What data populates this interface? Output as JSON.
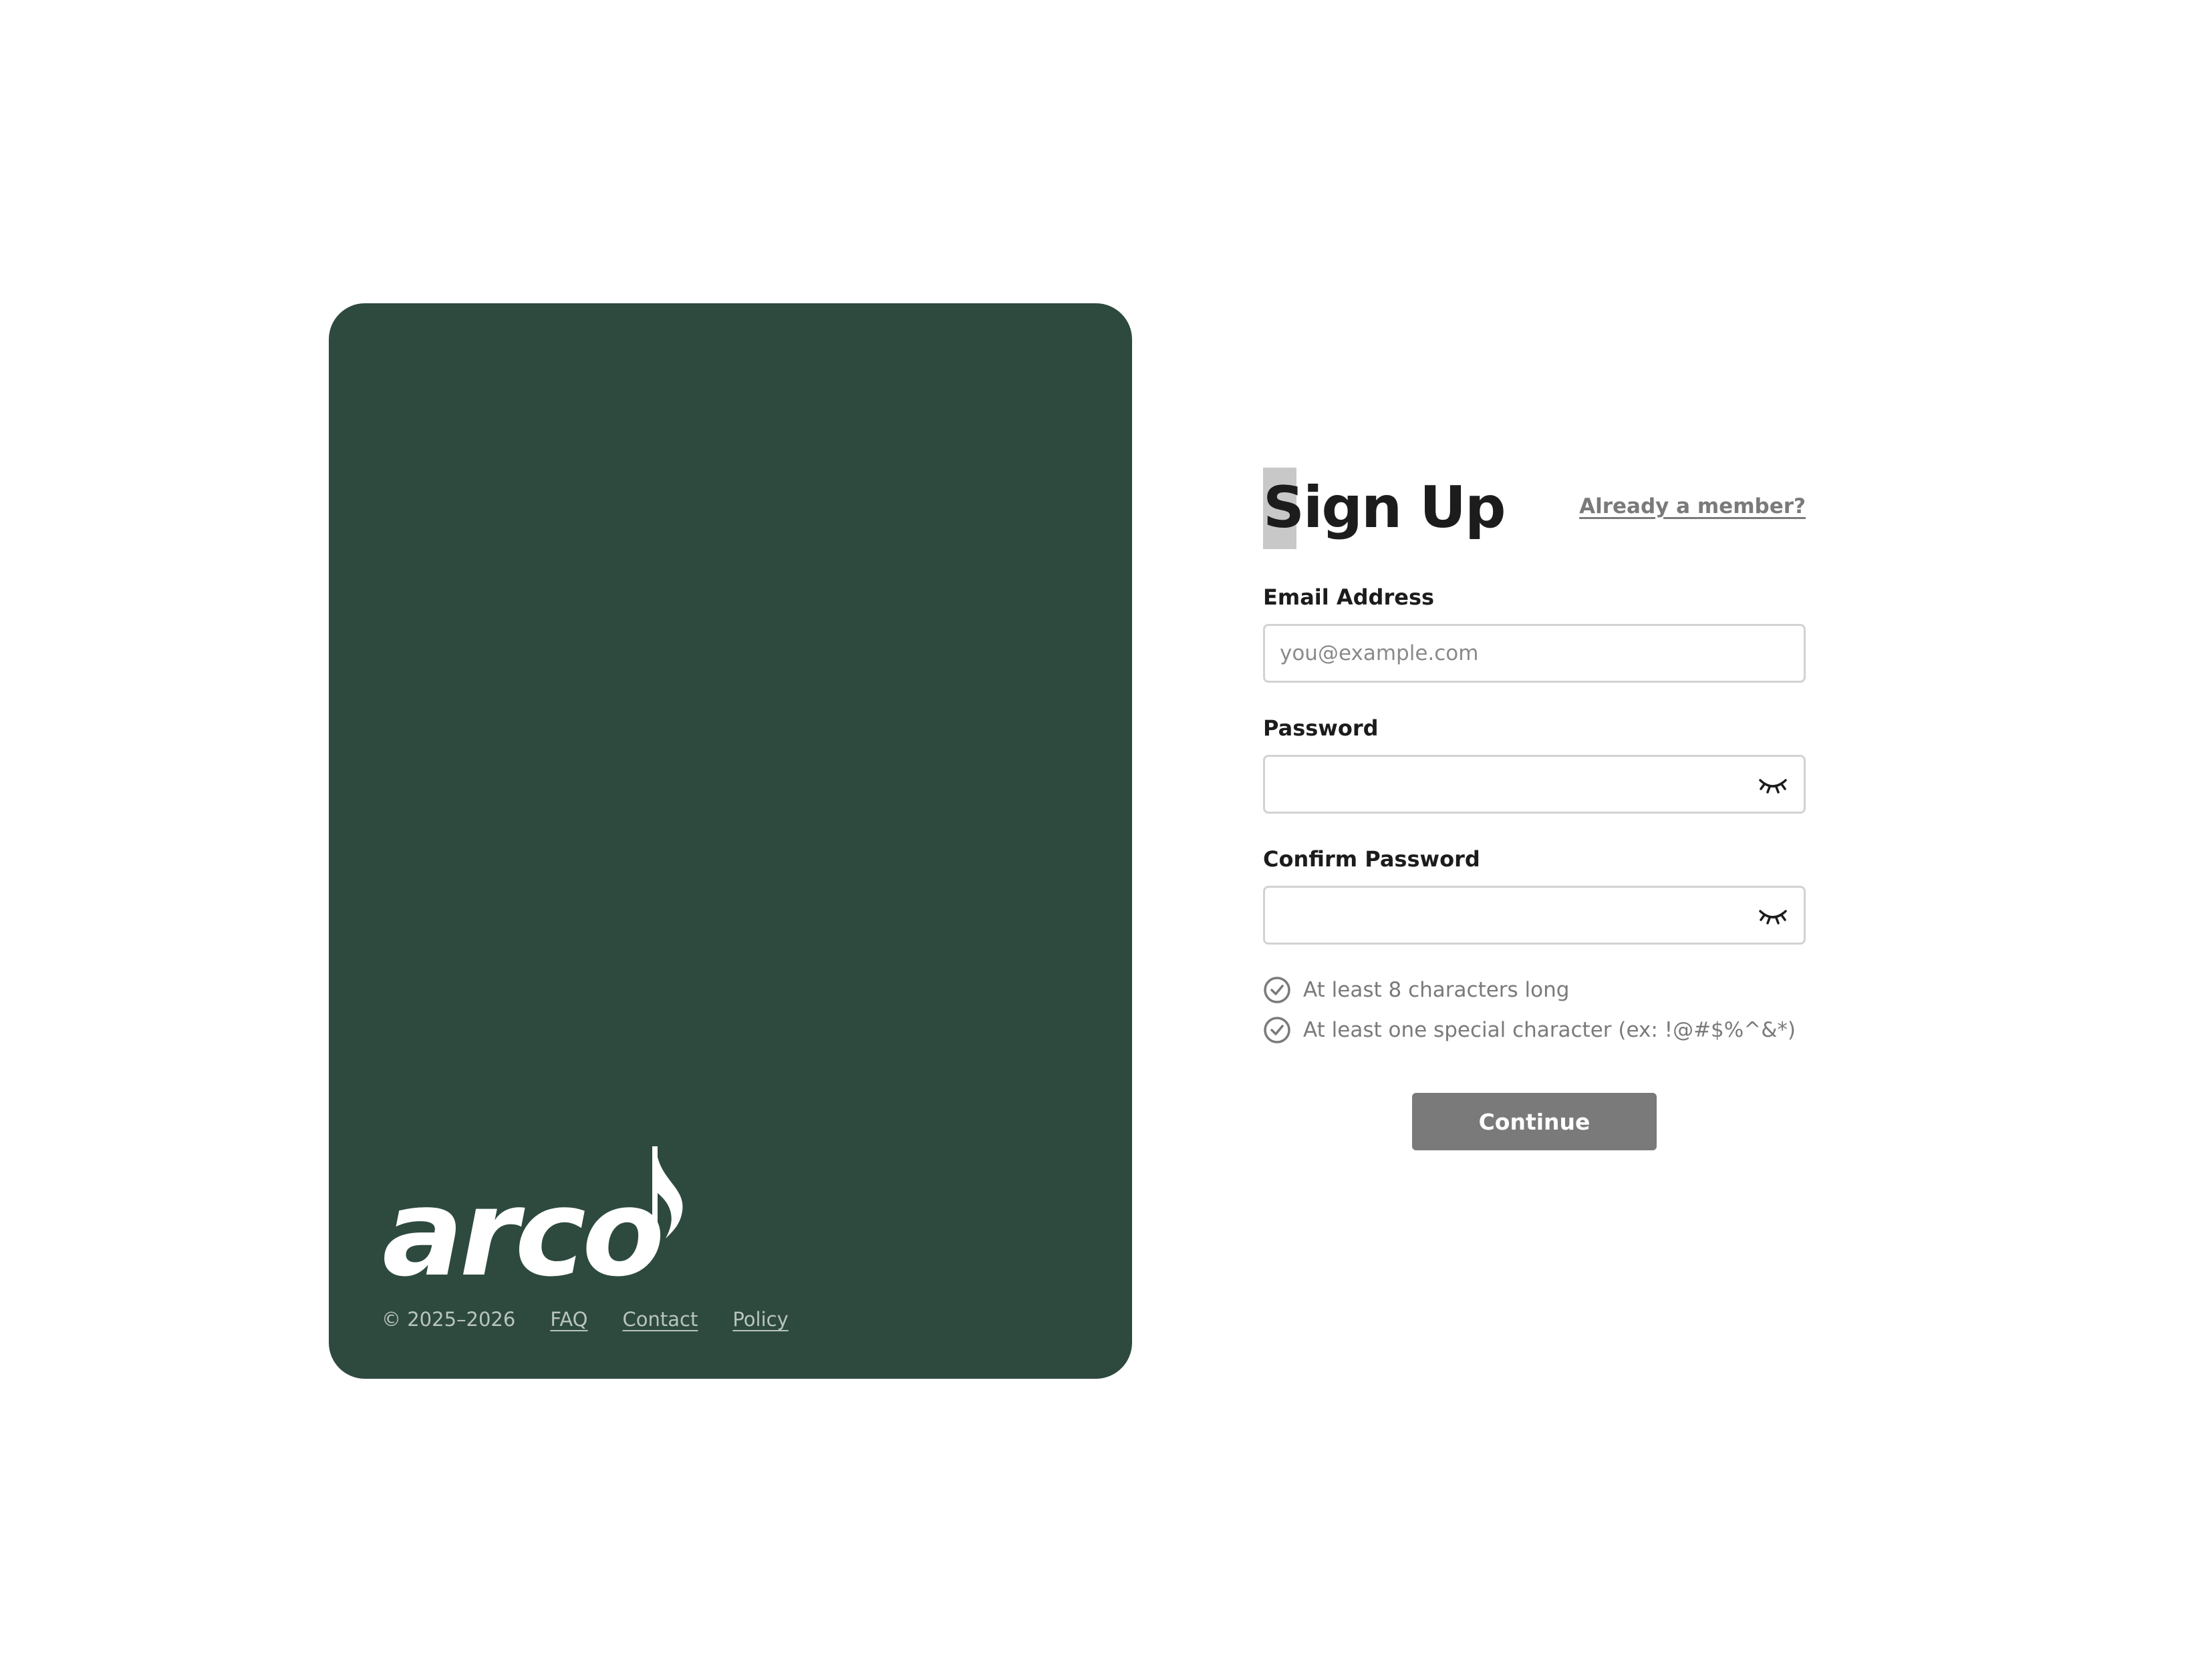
{
  "brand": {
    "logo_text": "arco",
    "panel_color": "#2e4a3e",
    "footer": {
      "copyright": "© 2025–2026",
      "links": [
        "FAQ",
        "Contact",
        "Policy"
      ]
    }
  },
  "form": {
    "title": "Sign Up",
    "member_link": "Already a member?",
    "email": {
      "label": "Email Address",
      "placeholder": "you@example.com",
      "value": ""
    },
    "password": {
      "label": "Password",
      "value": "",
      "toggle_icon": "eye-closed-icon"
    },
    "confirm_password": {
      "label": "Confirm Password",
      "value": "",
      "toggle_icon": "eye-closed-icon"
    },
    "rules": [
      "At least 8 characters long",
      "At least one special character (ex: !@#$%^&*)"
    ],
    "continue_label": "Continue",
    "button_color": "#7a7a7a"
  }
}
